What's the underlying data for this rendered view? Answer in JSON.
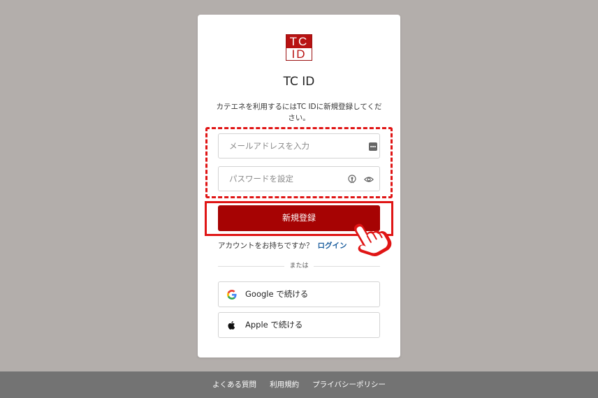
{
  "logo": {
    "line1": "TC",
    "line2": "ID",
    "color": "#b81212"
  },
  "title": "TC ID",
  "subtitle": "カテエネを利用するにはTC IDに新規登録してください。",
  "email": {
    "placeholder": "メールアドレスを入力",
    "value": "",
    "icon": "password-manager-icon"
  },
  "password": {
    "placeholder": "パスワードを設定",
    "value": "",
    "icons": [
      "key-lock-icon",
      "eye-icon"
    ]
  },
  "signup_button": {
    "label": "新規登録",
    "color": "#a60303"
  },
  "account_prompt": "アカウントをお持ちですか？",
  "login_link": "ログイン",
  "divider_text": "または",
  "social": {
    "google": {
      "label": "Google で続ける",
      "icon": "google-icon"
    },
    "apple": {
      "label": "Apple で続ける",
      "icon": "apple-icon"
    }
  },
  "footer": {
    "faq": "よくある質問",
    "terms": "利用規約",
    "privacy": "プライバシーポリシー"
  },
  "annotation": {
    "highlight_color": "#e01515",
    "pointer_icon": "pointing-hand-icon"
  }
}
